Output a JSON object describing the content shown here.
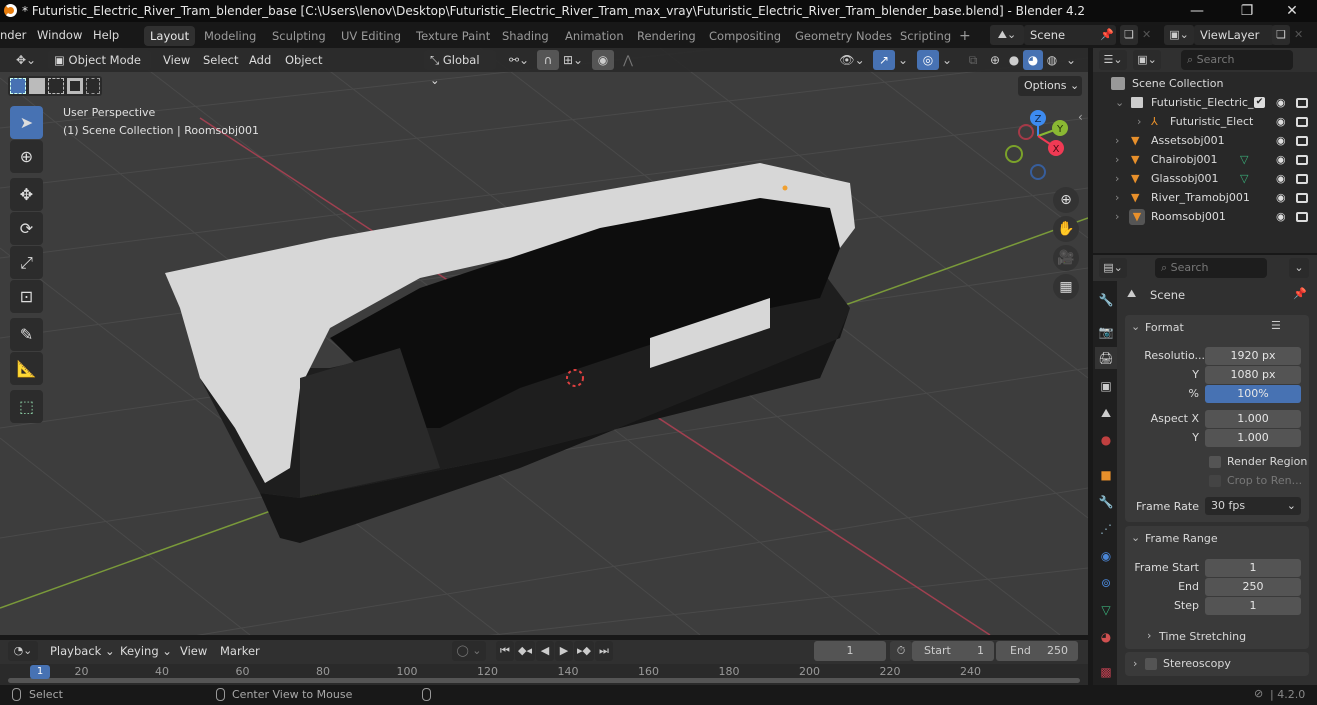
{
  "window": {
    "title": "* Futuristic_Electric_River_Tram_blender_base [C:\\Users\\lenov\\Desktop\\Futuristic_Electric_River_Tram_max_vray\\Futuristic_Electric_River_Tram_blender_base.blend] - Blender 4.2",
    "minimize": "—",
    "maximize": "❐",
    "close": "✕"
  },
  "menubar": {
    "menus": [
      "nder",
      "Window",
      "Help"
    ],
    "workspaces": [
      "Layout",
      "Modeling",
      "Sculpting",
      "UV Editing",
      "Texture Paint",
      "Shading",
      "Animation",
      "Rendering",
      "Compositing",
      "Geometry Nodes",
      "Scripting"
    ],
    "active_workspace": "Layout",
    "add_workspace": "+",
    "scene_name": "Scene",
    "view_layer": "ViewLayer"
  },
  "viewport_header": {
    "editor_type_icon": "3d-viewport-icon",
    "mode": "Object Mode",
    "menus": [
      "View",
      "Select",
      "Add",
      "Object"
    ],
    "transform_orientation": "Global",
    "options_label": "Options"
  },
  "viewport": {
    "perspective_label": "User Perspective",
    "collection_label": "(1) Scene Collection | Roomsobj001",
    "gizmo_axes": [
      "Z",
      "Y",
      "X"
    ],
    "tools": [
      "select-box",
      "cursor",
      "move",
      "rotate",
      "scale",
      "transform",
      "annotate",
      "measure",
      "add-cube"
    ],
    "nav_buttons": [
      "zoom",
      "pan",
      "camera",
      "ortho-grid"
    ]
  },
  "outliner": {
    "search_placeholder": "Search",
    "root": "Scene Collection",
    "items": [
      {
        "name": "Futuristic_Electric_",
        "type": "collection",
        "indent": 1,
        "checked": true
      },
      {
        "name": "Futuristic_Elect",
        "type": "empty",
        "indent": 2
      },
      {
        "name": "Assetsobj001",
        "type": "mesh",
        "indent": 1
      },
      {
        "name": "Chairobj001",
        "type": "mesh",
        "indent": 1
      },
      {
        "name": "Glassobj001",
        "type": "mesh",
        "indent": 1
      },
      {
        "name": "River_Tramobj001",
        "type": "mesh",
        "indent": 1
      },
      {
        "name": "Roomsobj001",
        "type": "mesh",
        "indent": 1,
        "selected": true
      }
    ]
  },
  "properties": {
    "search_placeholder": "Search",
    "context": "Scene",
    "format": {
      "title": "Format",
      "resolution_label": "Resolutio...",
      "resolution_x": "1920 px",
      "y_label": "Y",
      "resolution_y": "1080 px",
      "percent_label": "%",
      "percent": "100%",
      "aspect_x_label": "Aspect X",
      "aspect_x": "1.000",
      "aspect_y_label": "Y",
      "aspect_y": "1.000",
      "render_region": "Render Region",
      "crop": "Crop to Ren...",
      "frame_rate_label": "Frame Rate",
      "frame_rate": "30 fps"
    },
    "frame_range": {
      "title": "Frame Range",
      "start_label": "Frame Start",
      "start": "1",
      "end_label": "End",
      "end": "250",
      "step_label": "Step",
      "step": "1",
      "time_stretching": "Time Stretching"
    },
    "stereoscopy": "Stereoscopy"
  },
  "timeline": {
    "menus": [
      "Playback",
      "Keying",
      "View",
      "Marker"
    ],
    "current_frame": "1",
    "start_label": "Start",
    "start": "1",
    "end_label": "End",
    "end": "250",
    "ruler": [
      "20",
      "40",
      "60",
      "80",
      "100",
      "120",
      "140",
      "160",
      "180",
      "200",
      "220",
      "240"
    ],
    "playhead": "1"
  },
  "statusbar": {
    "select": "Select",
    "center_view": "Center View to Mouse",
    "version": "4.2.0"
  }
}
